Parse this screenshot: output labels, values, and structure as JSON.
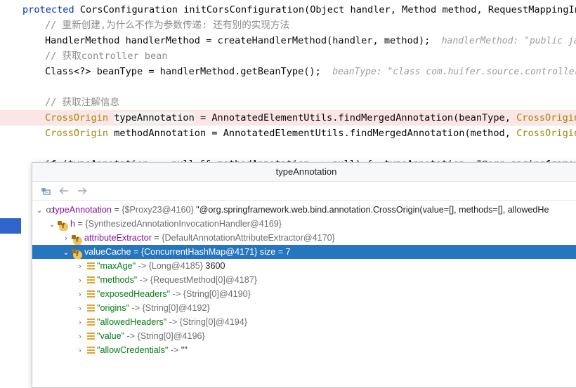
{
  "editor": {
    "lines": [
      {
        "parts": [
          {
            "t": "protected ",
            "c": "kw"
          },
          {
            "t": "CorsConfiguration ",
            "c": "id"
          },
          {
            "t": "initCorsConfiguration(Object handler, Method method, RequestMappingInfo",
            "c": "id"
          }
        ]
      },
      {
        "parts": [
          {
            "t": "// 重新创建,为什么不作为参数传递: 还有别的实现方法",
            "c": "cmtcn"
          }
        ]
      },
      {
        "parts": [
          {
            "t": "HandlerMethod handlerMethod = createHandlerMethod(handler, method);  ",
            "c": "id"
          },
          {
            "t": "handlerMethod: \"public jav",
            "c": "hint"
          }
        ]
      },
      {
        "parts": [
          {
            "t": "// 获取controller bean",
            "c": "cmtcn"
          }
        ]
      },
      {
        "parts": [
          {
            "t": "Class<?> beanType = handlerMethod.getBeanType();  ",
            "c": "id"
          },
          {
            "t": "beanType: \"class com.huifer.source.controller",
            "c": "hint"
          }
        ]
      },
      {
        "parts": []
      },
      {
        "parts": [
          {
            "t": "// 获取注解信息",
            "c": "cmtcn"
          }
        ]
      },
      {
        "parts": [
          {
            "t": "CrossOrigin ",
            "c": "cls"
          },
          {
            "t": "typeAnnotation",
            "c": "vbg"
          },
          {
            "t": " = AnnotatedElementUtils.findMergedAnnotation(beanType, ",
            "c": "id"
          },
          {
            "t": "CrossOrigin.c",
            "c": "cls"
          }
        ]
      },
      {
        "parts": [
          {
            "t": "CrossOrigin ",
            "c": "cls"
          },
          {
            "t": "methodAnnotation = AnnotatedElementUtils.findMergedAnnotation(method, ",
            "c": "id"
          },
          {
            "t": "CrossOrigin.c",
            "c": "cls"
          }
        ]
      },
      {
        "parts": []
      },
      {
        "parts": [
          {
            "t": "if (typeAnnotation == null && methodAnnotation == null) {  typeAnnotation: \"@org.springframework.",
            "c": "id"
          }
        ]
      }
    ]
  },
  "popup": {
    "title": "typeAnnotation",
    "toolbar": {
      "pin_icon": "pin-icon",
      "back_icon": "arrow-left-icon",
      "forward_icon": "arrow-right-icon"
    },
    "rows": [
      {
        "name": "typeAnnotation",
        "eq": " = ",
        "ref": "{$Proxy23@4160}",
        "extra": " \"@org.springframework.web.bind.annotation.CrossOrigin(value=[], methods=[], allowedHe"
      },
      {
        "name": "h",
        "eq": " = ",
        "ref": "{SynthesizedAnnotationInvocationHandler@4169}",
        "extra": ""
      },
      {
        "name": "attributeExtractor",
        "eq": " = ",
        "ref": "{DefaultAnnotationAttributeExtractor@4170}",
        "extra": ""
      },
      {
        "name": "valueCache",
        "eq": " = ",
        "ref": "{ConcurrentHashMap@4171}",
        "extra": "  size = 7"
      }
    ],
    "entries": [
      {
        "key": "\"maxAge\"",
        "arrow": " -> ",
        "ref": "{Long@4185}",
        "val": " 3600"
      },
      {
        "key": "\"methods\"",
        "arrow": " -> ",
        "ref": "{RequestMethod[0]@4187}",
        "val": ""
      },
      {
        "key": "\"exposedHeaders\"",
        "arrow": " -> ",
        "ref": "{String[0]@4190}",
        "val": ""
      },
      {
        "key": "\"origins\"",
        "arrow": " -> ",
        "ref": "{String[0]@4192}",
        "val": ""
      },
      {
        "key": "\"allowedHeaders\"",
        "arrow": " -> ",
        "ref": "{String[0]@4194}",
        "val": ""
      },
      {
        "key": "\"value\"",
        "arrow": " -> ",
        "ref": "{String[0]@4196}",
        "val": ""
      },
      {
        "key": "\"allowCredentials\"",
        "arrow": " -> ",
        "ref": "",
        "val": "\"\""
      }
    ]
  }
}
